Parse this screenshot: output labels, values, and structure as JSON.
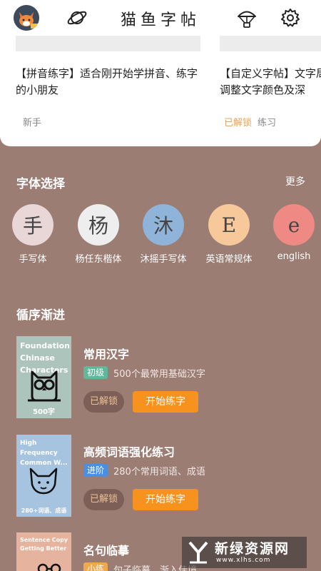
{
  "header": {
    "title": "猫鱼字帖",
    "icons": [
      "planet-icon",
      "parachute-icon",
      "gear-icon"
    ]
  },
  "cards": [
    {
      "text": "【拼音练字】适合刚开始学拼音、练字的小朋友",
      "tag": "新手"
    },
    {
      "text": "【自定义字帖】文字局调整文字颜色及深",
      "gold_tag": "已解锁",
      "tag": "练习"
    }
  ],
  "fonts_section": {
    "title": "字体选择",
    "more": "更多",
    "items": [
      {
        "glyph": "手",
        "label": "手写体",
        "color": "#e8d7d6"
      },
      {
        "glyph": "杨",
        "label": "杨任东楷体",
        "color": "#eeeeee"
      },
      {
        "glyph": "沐",
        "label": "沐摇手写体",
        "color": "#8fb3d9"
      },
      {
        "glyph": "E",
        "label": "英语常规体",
        "color": "#f6c89a"
      },
      {
        "glyph": "e",
        "label": "english",
        "color": "#ee8a83"
      }
    ]
  },
  "courses_section": {
    "title": "循序渐进",
    "items": [
      {
        "cover_text": "Foundation Chinase Characters",
        "cover_count": "500字",
        "cover_color": "#adc4bd",
        "title": "常用汉字",
        "level": "初级",
        "level_color": "#5fb89a",
        "desc": "500个最常用基础汉字",
        "unlock": "已解锁",
        "start": "开始练字"
      },
      {
        "cover_text": "High Frequency Common W...",
        "cover_count": "280+词语、成语",
        "cover_color": "#a6c3e0",
        "title": "高频词语强化练习",
        "level": "进阶",
        "level_color": "#4a8fe0",
        "desc": "280个常用词语、成语",
        "unlock": "已解锁",
        "start": "开始练字"
      },
      {
        "cover_text": "Sentence Copy Getting Better",
        "cover_count": "",
        "cover_color": "#e5b39e",
        "title": "名句临摹",
        "level": "小练",
        "level_color": "#f0a94a",
        "desc": "句子临摹，渐入佳境",
        "unlock": "",
        "start": ""
      }
    ]
  },
  "watermark": {
    "name": "新绿资源网",
    "url": "www.xlhs.com"
  }
}
